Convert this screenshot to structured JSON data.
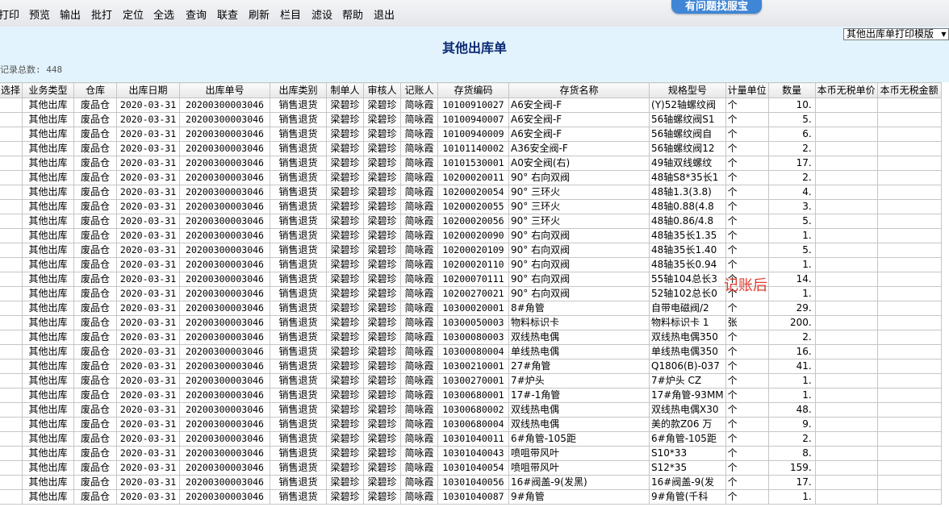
{
  "toolbar": {
    "items": [
      "打印",
      "预览",
      "输出",
      "批打",
      "定位",
      "全选",
      "查询",
      "联查",
      "刷新",
      "栏目",
      "滤设",
      "帮助",
      "退出"
    ],
    "help_badge": "有问题找服宝"
  },
  "header": {
    "title": "其他出库单",
    "record_count": "记录总数: 448",
    "template_select": "其他出库单打印模版"
  },
  "grid": {
    "columns": [
      "选择",
      "业务类型",
      "仓库",
      "出库日期",
      "出库单号",
      "出库类别",
      "制单人",
      "审核人",
      "记账人",
      "存货编码",
      "存货名称",
      "规格型号",
      "计量单位",
      "数量",
      "本币无税单价",
      "本币无税金额"
    ],
    "rows": [
      [
        "",
        "其他出库",
        "废品仓",
        "2020-03-31",
        "20200300003046",
        "销售退货",
        "梁碧珍",
        "梁碧珍",
        "简咏霞",
        "10100910027",
        "A6安全阀-F",
        "(Y)52轴螺纹阀",
        "个",
        "10.",
        "",
        ""
      ],
      [
        "",
        "其他出库",
        "废品仓",
        "2020-03-31",
        "20200300003046",
        "销售退货",
        "梁碧珍",
        "梁碧珍",
        "简咏霞",
        "10100940007",
        "A6安全阀-F",
        "56轴螺纹阀S1",
        "个",
        "5.",
        "",
        ""
      ],
      [
        "",
        "其他出库",
        "废品仓",
        "2020-03-31",
        "20200300003046",
        "销售退货",
        "梁碧珍",
        "梁碧珍",
        "简咏霞",
        "10100940009",
        "A6安全阀-F",
        "56轴螺纹阀自",
        "个",
        "6.",
        "",
        ""
      ],
      [
        "",
        "其他出库",
        "废品仓",
        "2020-03-31",
        "20200300003046",
        "销售退货",
        "梁碧珍",
        "梁碧珍",
        "简咏霞",
        "10101140002",
        "A36安全阀-F",
        "56轴螺纹阀12",
        "个",
        "2.",
        "",
        ""
      ],
      [
        "",
        "其他出库",
        "废品仓",
        "2020-03-31",
        "20200300003046",
        "销售退货",
        "梁碧珍",
        "梁碧珍",
        "简咏霞",
        "10101530001",
        "A0安全阀(右)",
        "49轴双线螺纹",
        "个",
        "17.",
        "",
        ""
      ],
      [
        "",
        "其他出库",
        "废品仓",
        "2020-03-31",
        "20200300003046",
        "销售退货",
        "梁碧珍",
        "梁碧珍",
        "简咏霞",
        "10200020011",
        "90° 右向双阀",
        "48轴S8*35长1",
        "个",
        "2.",
        "",
        ""
      ],
      [
        "",
        "其他出库",
        "废品仓",
        "2020-03-31",
        "20200300003046",
        "销售退货",
        "梁碧珍",
        "梁碧珍",
        "简咏霞",
        "10200020054",
        "90° 三环火",
        "48轴1.3(3.8)",
        "个",
        "4.",
        "",
        ""
      ],
      [
        "",
        "其他出库",
        "废品仓",
        "2020-03-31",
        "20200300003046",
        "销售退货",
        "梁碧珍",
        "梁碧珍",
        "简咏霞",
        "10200020055",
        "90° 三环火",
        "48轴0.88(4.8",
        "个",
        "3.",
        "",
        ""
      ],
      [
        "",
        "其他出库",
        "废品仓",
        "2020-03-31",
        "20200300003046",
        "销售退货",
        "梁碧珍",
        "梁碧珍",
        "简咏霞",
        "10200020056",
        "90° 三环火",
        "48轴0.86/4.8",
        "个",
        "5.",
        "",
        ""
      ],
      [
        "",
        "其他出库",
        "废品仓",
        "2020-03-31",
        "20200300003046",
        "销售退货",
        "梁碧珍",
        "梁碧珍",
        "简咏霞",
        "10200020090",
        "90° 右向双阀",
        "48轴35长1.35",
        "个",
        "1.",
        "",
        ""
      ],
      [
        "",
        "其他出库",
        "废品仓",
        "2020-03-31",
        "20200300003046",
        "销售退货",
        "梁碧珍",
        "梁碧珍",
        "简咏霞",
        "10200020109",
        "90° 右向双阀",
        "48轴35长1.40",
        "个",
        "5.",
        "",
        ""
      ],
      [
        "",
        "其他出库",
        "废品仓",
        "2020-03-31",
        "20200300003046",
        "销售退货",
        "梁碧珍",
        "梁碧珍",
        "简咏霞",
        "10200020110",
        "90° 右向双阀",
        "48轴35长0.94",
        "个",
        "1.",
        "",
        ""
      ],
      [
        "",
        "其他出库",
        "废品仓",
        "2020-03-31",
        "20200300003046",
        "销售退货",
        "梁碧珍",
        "梁碧珍",
        "简咏霞",
        "10200070111",
        "90° 右向双阀",
        "55轴104总长3",
        "个",
        "14.",
        "",
        ""
      ],
      [
        "",
        "其他出库",
        "废品仓",
        "2020-03-31",
        "20200300003046",
        "销售退货",
        "梁碧珍",
        "梁碧珍",
        "简咏霞",
        "10200270021",
        "90° 右向双阀",
        "52轴102总长0",
        "个",
        "1.",
        "",
        ""
      ],
      [
        "",
        "其他出库",
        "废品仓",
        "2020-03-31",
        "20200300003046",
        "销售退货",
        "梁碧珍",
        "梁碧珍",
        "简咏霞",
        "10300020001",
        "8#角管",
        "自带电磁阀/2",
        "个",
        "29.",
        "",
        ""
      ],
      [
        "",
        "其他出库",
        "废品仓",
        "2020-03-31",
        "20200300003046",
        "销售退货",
        "梁碧珍",
        "梁碧珍",
        "简咏霞",
        "10300050003",
        "物料标识卡",
        "物料标识卡 1",
        "张",
        "200.",
        "",
        ""
      ],
      [
        "",
        "其他出库",
        "废品仓",
        "2020-03-31",
        "20200300003046",
        "销售退货",
        "梁碧珍",
        "梁碧珍",
        "简咏霞",
        "10300080003",
        "双线热电偶",
        "双线热电偶350",
        "个",
        "2.",
        "",
        ""
      ],
      [
        "",
        "其他出库",
        "废品仓",
        "2020-03-31",
        "20200300003046",
        "销售退货",
        "梁碧珍",
        "梁碧珍",
        "简咏霞",
        "10300080004",
        "单线热电偶",
        "单线热电偶350",
        "个",
        "16.",
        "",
        ""
      ],
      [
        "",
        "其他出库",
        "废品仓",
        "2020-03-31",
        "20200300003046",
        "销售退货",
        "梁碧珍",
        "梁碧珍",
        "简咏霞",
        "10300210001",
        "27#角管",
        "Q1806(B)-037",
        "个",
        "41.",
        "",
        ""
      ],
      [
        "",
        "其他出库",
        "废品仓",
        "2020-03-31",
        "20200300003046",
        "销售退货",
        "梁碧珍",
        "梁碧珍",
        "简咏霞",
        "10300270001",
        "7#炉头",
        "7#炉头 CZ",
        "个",
        "1.",
        "",
        ""
      ],
      [
        "",
        "其他出库",
        "废品仓",
        "2020-03-31",
        "20200300003046",
        "销售退货",
        "梁碧珍",
        "梁碧珍",
        "简咏霞",
        "10300680001",
        "17#-1角管",
        "17#角管-93MM",
        "个",
        "1.",
        "",
        ""
      ],
      [
        "",
        "其他出库",
        "废品仓",
        "2020-03-31",
        "20200300003046",
        "销售退货",
        "梁碧珍",
        "梁碧珍",
        "简咏霞",
        "10300680002",
        "双线热电偶",
        "双线热电偶X30",
        "个",
        "48.",
        "",
        ""
      ],
      [
        "",
        "其他出库",
        "废品仓",
        "2020-03-31",
        "20200300003046",
        "销售退货",
        "梁碧珍",
        "梁碧珍",
        "简咏霞",
        "10300680004",
        "双线热电偶",
        "美的款Z06 万",
        "个",
        "9.",
        "",
        ""
      ],
      [
        "",
        "其他出库",
        "废品仓",
        "2020-03-31",
        "20200300003046",
        "销售退货",
        "梁碧珍",
        "梁碧珍",
        "简咏霞",
        "10301040011",
        "6#角管-105距",
        "6#角管-105距",
        "个",
        "2.",
        "",
        ""
      ],
      [
        "",
        "其他出库",
        "废品仓",
        "2020-03-31",
        "20200300003046",
        "销售退货",
        "梁碧珍",
        "梁碧珍",
        "简咏霞",
        "10301040043",
        "喷咀带风叶",
        "S10*33",
        "个",
        "8.",
        "",
        ""
      ],
      [
        "",
        "其他出库",
        "废品仓",
        "2020-03-31",
        "20200300003046",
        "销售退货",
        "梁碧珍",
        "梁碧珍",
        "简咏霞",
        "10301040054",
        "喷咀带风叶",
        "S12*35",
        "个",
        "159.",
        "",
        ""
      ],
      [
        "",
        "其他出库",
        "废品仓",
        "2020-03-31",
        "20200300003046",
        "销售退货",
        "梁碧珍",
        "梁碧珍",
        "简咏霞",
        "10301040056",
        "16#阀盖-9(发黑)",
        "16#阀盖-9(发",
        "个",
        "17.",
        "",
        ""
      ],
      [
        "",
        "其他出库",
        "废品仓",
        "2020-03-31",
        "20200300003046",
        "销售退货",
        "梁碧珍",
        "梁碧珍",
        "简咏霞",
        "10301040087",
        "9#角管",
        "9#角管(千科",
        "个",
        "1.",
        "",
        ""
      ]
    ]
  },
  "annotation": "记账后"
}
